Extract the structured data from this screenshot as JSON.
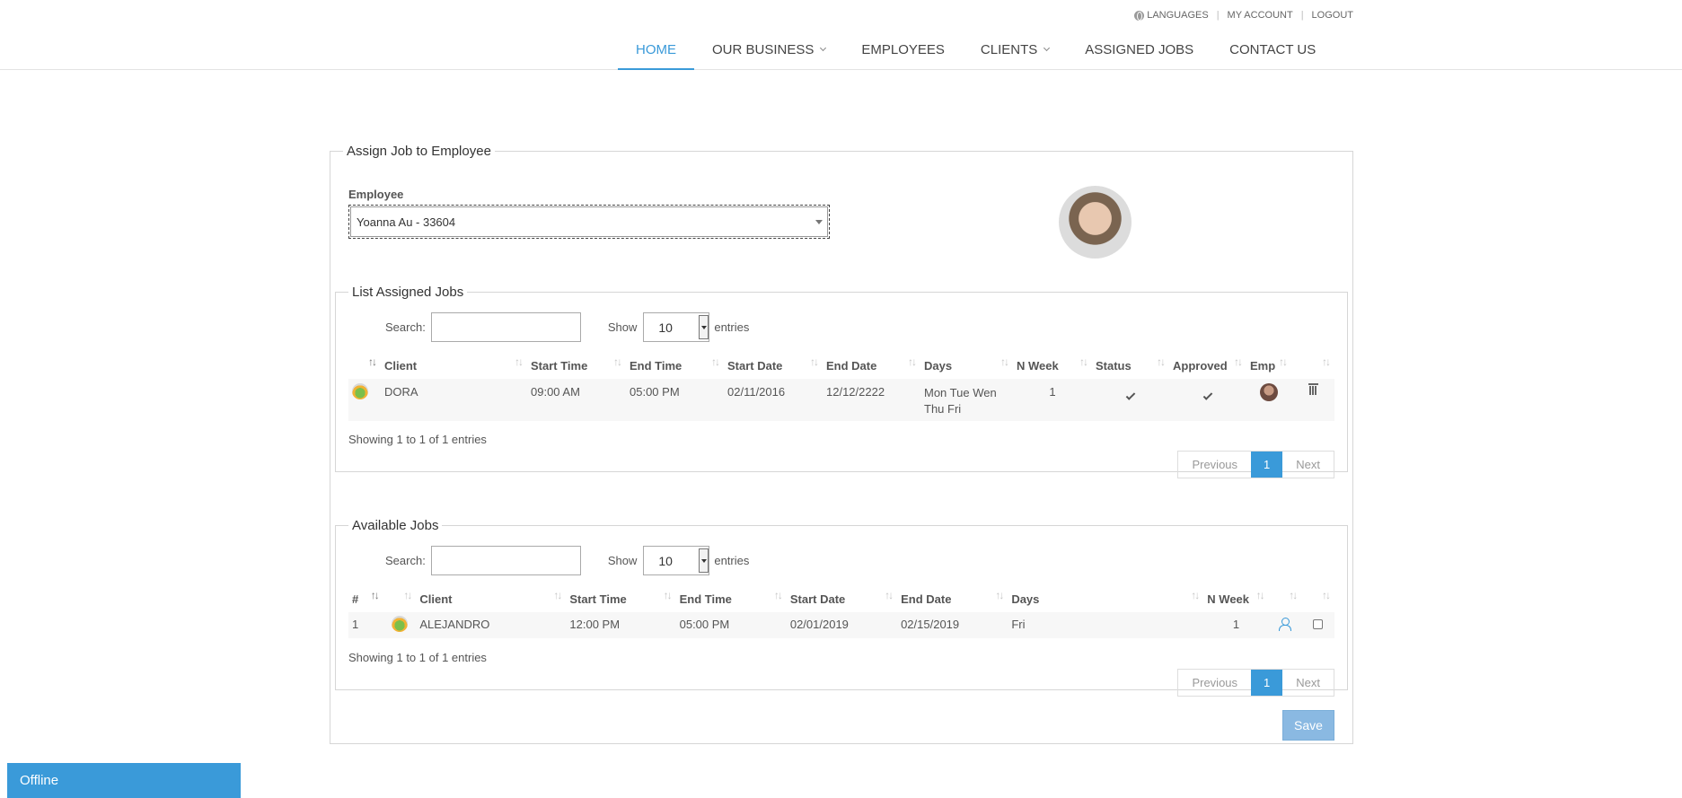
{
  "util_links": {
    "languages": "LANGUAGES",
    "my_account": "MY ACCOUNT",
    "logout": "LOGOUT"
  },
  "nav": {
    "home": "HOME",
    "our_business": "OUR BUSINESS",
    "employees": "EMPLOYEES",
    "clients": "CLIENTS",
    "assigned_jobs": "ASSIGNED JOBS",
    "contact_us": "CONTACT US"
  },
  "assign": {
    "legend": "Assign Job to Employee",
    "employee_label": "Employee",
    "employee_value": "Yoanna Au - 33604"
  },
  "assigned_jobs": {
    "legend": "List Assigned Jobs",
    "search_label": "Search:",
    "show_label": "Show",
    "show_value": "10",
    "entries_label": "entries",
    "headers": {
      "client": "Client",
      "start_time": "Start Time",
      "end_time": "End Time",
      "start_date": "Start Date",
      "end_date": "End Date",
      "days": "Days",
      "n_week": "N Week",
      "status": "Status",
      "approved": "Approved",
      "emp": "Emp"
    },
    "rows": [
      {
        "client": "DORA",
        "start_time": "09:00 AM",
        "end_time": "05:00 PM",
        "start_date": "02/11/2016",
        "end_date": "12/12/2222",
        "days_line1": "Mon Tue Wen",
        "days_line2": "Thu Fri",
        "n_week": "1"
      }
    ],
    "info": "Showing 1 to 1 of 1 entries",
    "pager": {
      "previous": "Previous",
      "page": "1",
      "next": "Next"
    }
  },
  "available_jobs": {
    "legend": "Available Jobs",
    "search_label": "Search:",
    "show_label": "Show",
    "show_value": "10",
    "entries_label": "entries",
    "headers": {
      "num": "#",
      "client": "Client",
      "start_time": "Start Time",
      "end_time": "End Time",
      "start_date": "Start Date",
      "end_date": "End Date",
      "days": "Days",
      "n_week": "N Week"
    },
    "rows": [
      {
        "num": "1",
        "client": "ALEJANDRO",
        "start_time": "12:00 PM",
        "end_time": "05:00 PM",
        "start_date": "02/01/2019",
        "end_date": "02/15/2019",
        "days": "Fri",
        "n_week": "1"
      }
    ],
    "info": "Showing 1 to 1 of 1 entries",
    "pager": {
      "previous": "Previous",
      "page": "1",
      "next": "Next"
    }
  },
  "save_label": "Save",
  "chat_status": "Offline",
  "colors": {
    "accent": "#3a9ad9",
    "save_button": "#8ab9e2"
  }
}
